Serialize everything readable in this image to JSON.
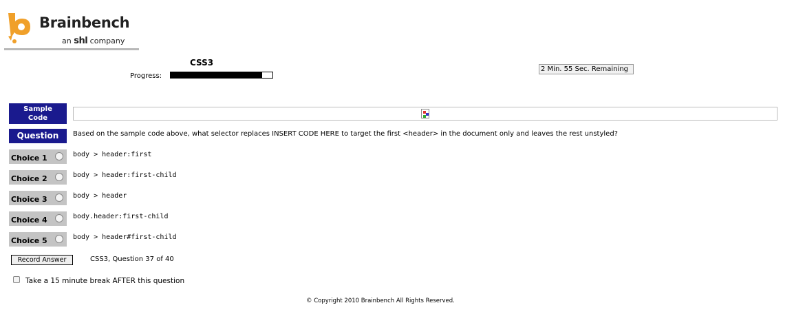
{
  "brand": {
    "name": "Brainbench",
    "tagline_prefix": "an",
    "tagline_mark": "shl",
    "tagline_suffix": "company",
    "accent": "#f0a02a"
  },
  "test": {
    "title": "CSS3",
    "progress_label": "Progress:",
    "progress_fraction": 0.9
  },
  "timer": {
    "text": "2 Min. 55 Sec. Remaining"
  },
  "sample": {
    "label_line1": "Sample",
    "label_line2": "Code"
  },
  "question": {
    "label": "Question",
    "text": "Based on the sample code above, what selector replaces INSERT CODE HERE to target the first <header> in the document only and leaves the rest unstyled?"
  },
  "choices": [
    {
      "label": "Choice 1",
      "text": "body > header:first"
    },
    {
      "label": "Choice 2",
      "text": "body > header:first-child"
    },
    {
      "label": "Choice 3",
      "text": "body > header"
    },
    {
      "label": "Choice 4",
      "text": "body.header:first-child"
    },
    {
      "label": "Choice 5",
      "text": "body > header#first-child"
    }
  ],
  "actions": {
    "record_label": "Record Answer",
    "question_count": "CSS3, Question 37 of 40"
  },
  "break_option": {
    "label": "Take a 15 minute break AFTER this question"
  },
  "footer": {
    "copyright": "© Copyright 2010 Brainbench All Rights Reserved."
  },
  "colors": {
    "label_blue": "#1a1a8e",
    "choice_gray": "#c4c4c4"
  }
}
